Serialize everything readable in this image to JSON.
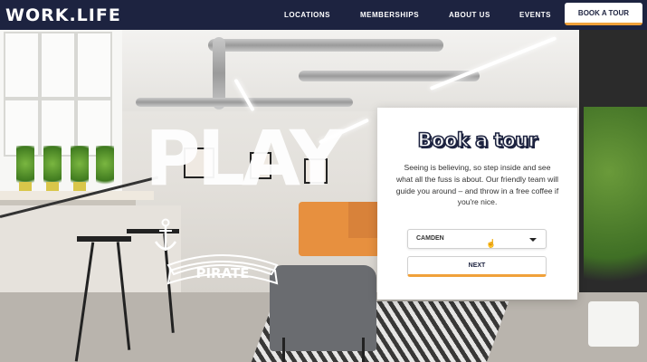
{
  "brand": {
    "logo": "WORK.LIFE"
  },
  "nav": {
    "items": [
      {
        "label": "LOCATIONS"
      },
      {
        "label": "MEMBERSHIPS"
      },
      {
        "label": "ABOUT US"
      },
      {
        "label": "EVENTS"
      }
    ],
    "cta_label": "BOOK A TOUR"
  },
  "hero": {
    "art_words": [
      "PLAY",
      "PIRATE"
    ]
  },
  "card": {
    "title": "Book a tour",
    "body": "Seeing is believing, so step inside and see what all the fuss is about. Our friendly team will guide you around – and throw in a free coffee if you're nice.",
    "location_select": {
      "value": "CAMDEN"
    },
    "next_label": "NEXT"
  },
  "colors": {
    "nav_bg": "#1d2340",
    "accent": "#f0a13a",
    "text_dark": "#1d2340"
  },
  "icons": [
    "chevron-down-icon",
    "pointer-cursor-icon",
    "anchor-icon"
  ]
}
